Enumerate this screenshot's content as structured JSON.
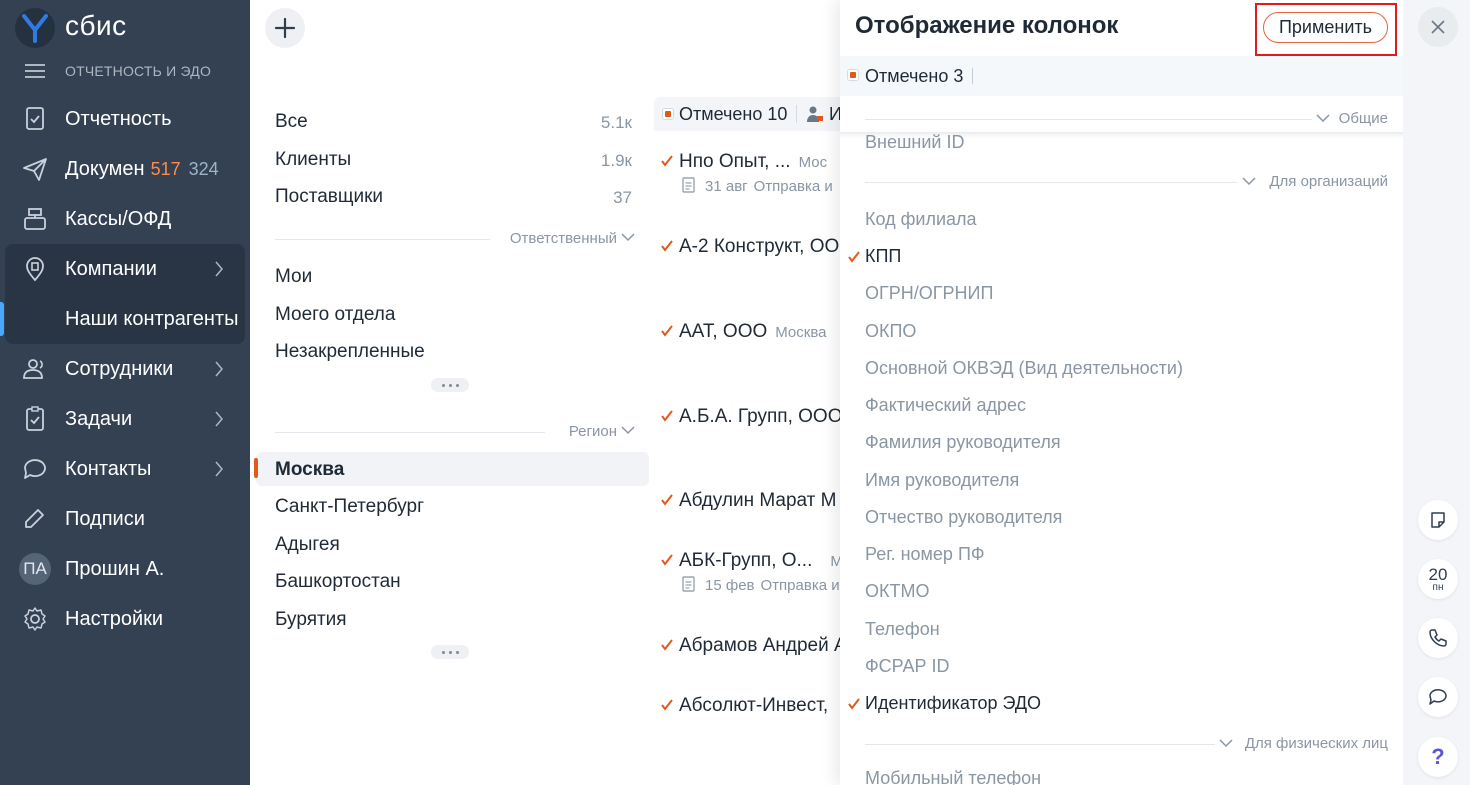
{
  "brand": {
    "name": "сбис",
    "section": "ОТЧЕТНОСТЬ И ЭДО"
  },
  "sidebar": {
    "items": [
      {
        "label": "Отчетность",
        "icon": "report-icon"
      },
      {
        "label": "Докумен",
        "icon": "paper-plane-icon",
        "badge1": "517",
        "badge2": "324"
      },
      {
        "label": "Кассы/ОФД",
        "icon": "cash-register-icon"
      },
      {
        "label": "Компании",
        "icon": "building-pin-icon"
      },
      {
        "label": "Наши контрагенты"
      },
      {
        "label": "Сотрудники",
        "icon": "people-icon"
      },
      {
        "label": "Задачи",
        "icon": "clipboard-check-icon"
      },
      {
        "label": "Контакты",
        "icon": "chat-icon"
      },
      {
        "label": "Подписи",
        "icon": "pen-icon"
      },
      {
        "label": "Прошин А.",
        "avatar": "ПА"
      },
      {
        "label": "Настройки",
        "icon": "gear-icon"
      }
    ]
  },
  "filters": {
    "top": [
      {
        "label": "Все",
        "count": "5.1к"
      },
      {
        "label": "Клиенты",
        "count": "1.9к"
      },
      {
        "label": "Поставщики",
        "count": "37"
      }
    ],
    "responsible_title": "Ответственный",
    "responsible": [
      "Мои",
      "Моего отдела",
      "Незакрепленные"
    ],
    "region_title": "Регион",
    "regions": [
      "Москва",
      "Санкт-Петербург",
      "Адыгея",
      "Башкортостан",
      "Бурятия"
    ]
  },
  "list": {
    "header": {
      "marked": "Отмечено 10",
      "cut": "И"
    },
    "rows": [
      {
        "name": "Нпо Опыт, ...",
        "city": "Мос",
        "date": "31 авг",
        "status": "Отправка и"
      },
      {
        "name": "А-2 Конструкт, ОО",
        "city": ""
      },
      {
        "name": "ААТ, ООО",
        "city": "Москва"
      },
      {
        "name": "А.Б.А. Групп, ООО",
        "city": ""
      },
      {
        "name": "Абдулин Марат М",
        "city": ""
      },
      {
        "name": "АБК-Групп, О...",
        "city": "М",
        "date": "15 фев",
        "status": "Отправка и"
      },
      {
        "name": "Абрамов Андрей А",
        "city": ""
      },
      {
        "name": "Абсолют-Инвест,",
        "city": ""
      }
    ]
  },
  "panel": {
    "title": "Отображение колонок",
    "apply_label": "Применить",
    "marked_label": "Отмечено 3",
    "groups": {
      "general": "Общие",
      "orgs": "Для организаций",
      "persons": "Для физических лиц"
    },
    "items": [
      {
        "label": "Внешний ID",
        "checked": false
      },
      {
        "label": "Код филиала",
        "checked": false
      },
      {
        "label": "КПП",
        "checked": true
      },
      {
        "label": "ОГРН/ОГРНИП",
        "checked": false
      },
      {
        "label": "ОКПО",
        "checked": false
      },
      {
        "label": "Основной ОКВЭД (Вид деятельности)",
        "checked": false
      },
      {
        "label": "Фактический адрес",
        "checked": false
      },
      {
        "label": "Фамилия руководителя",
        "checked": false
      },
      {
        "label": "Имя руководителя",
        "checked": false
      },
      {
        "label": "Отчество руководителя",
        "checked": false
      },
      {
        "label": "Рег. номер ПФ",
        "checked": false
      },
      {
        "label": "ОКТМО",
        "checked": false
      },
      {
        "label": "Телефон",
        "checked": false
      },
      {
        "label": "ФСРАР ID",
        "checked": false
      },
      {
        "label": "Идентификатор ЭДО",
        "checked": true
      },
      {
        "label": "Мобильный телефон",
        "checked": false
      }
    ]
  },
  "rail": {
    "calendar_day": "20",
    "calendar_weekday": "пн",
    "help": "?"
  },
  "colors": {
    "sidebar": "#344153",
    "accent_orange": "#e05a1b",
    "badge_orange": "#ff8a4d",
    "highlight_red": "#e5181a"
  }
}
